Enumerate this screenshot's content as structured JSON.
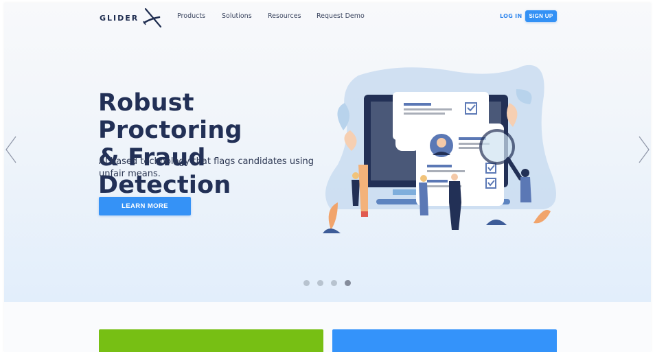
{
  "brand": {
    "name": "GLIDER",
    "logo_icon": "glider-plane-icon"
  },
  "nav": {
    "links": [
      "Products",
      "Solutions",
      "Resources",
      "Request Demo"
    ],
    "login_label": "LOG IN",
    "signup_label": "SIGN UP"
  },
  "hero": {
    "headline_line1": "Robust Proctoring",
    "headline_line2": "& Fraud Detection",
    "subtitle": "AI based technology that flags candidates using unfair means.",
    "cta_label": "LEARN MORE",
    "illustration": "document-verification-illustration",
    "prev_icon": "chevron-left-icon",
    "next_icon": "chevron-right-icon"
  },
  "carousel": {
    "slides": 4,
    "active_index": 3
  },
  "colors": {
    "primary": "#3592f6",
    "heading": "#223056",
    "card_green": "#77bf14",
    "card_blue": "#3493fa"
  },
  "cards": [
    "green",
    "blue"
  ]
}
